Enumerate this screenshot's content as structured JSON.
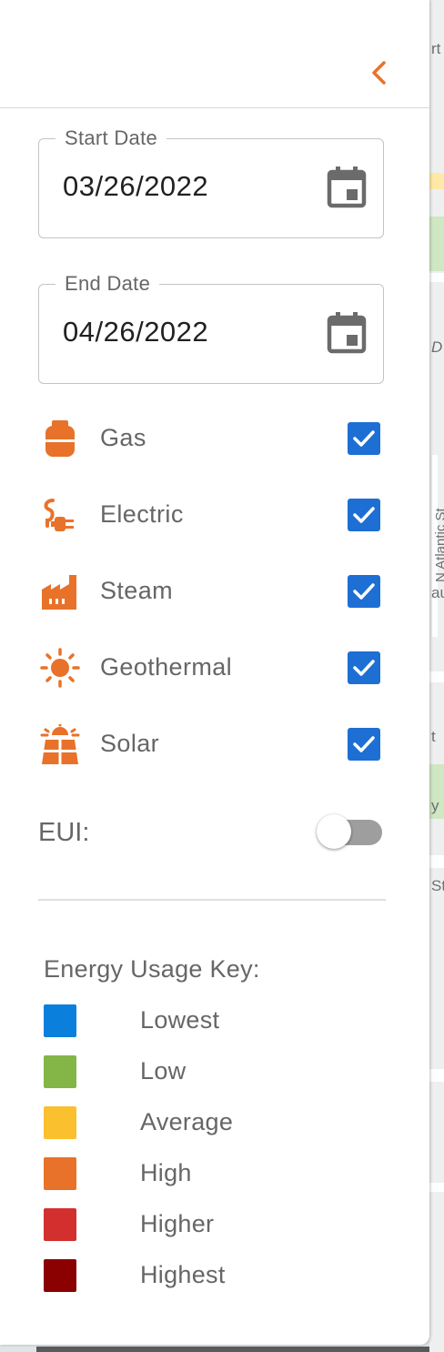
{
  "colors": {
    "accent_orange": "#e8722a",
    "checkbox_blue": "#1d6fd4",
    "text_gray": "#666666"
  },
  "header": {
    "collapse_icon": "chevron-left-icon"
  },
  "start_date": {
    "label": "Start Date",
    "value": "03/26/2022",
    "icon": "calendar-icon"
  },
  "end_date": {
    "label": "End Date",
    "value": "04/26/2022",
    "icon": "calendar-icon"
  },
  "utilities": [
    {
      "label": "Gas",
      "icon": "gas-tank-icon",
      "checked": true
    },
    {
      "label": "Electric",
      "icon": "power-plug-icon",
      "checked": true
    },
    {
      "label": "Steam",
      "icon": "factory-icon",
      "checked": true
    },
    {
      "label": "Geothermal",
      "icon": "sun-icon",
      "checked": true
    },
    {
      "label": "Solar",
      "icon": "solar-panel-icon",
      "checked": true
    }
  ],
  "eui": {
    "label": "EUI:",
    "enabled": false
  },
  "energy_key": {
    "title": "Energy Usage Key:",
    "items": [
      {
        "label": "Lowest",
        "color": "#0b7fdc"
      },
      {
        "label": "Low",
        "color": "#84b547"
      },
      {
        "label": "Average",
        "color": "#fbc02d"
      },
      {
        "label": "High",
        "color": "#e8722a"
      },
      {
        "label": "Higher",
        "color": "#d32f2f"
      },
      {
        "label": "Highest",
        "color": "#8b0000"
      }
    ]
  },
  "map": {
    "labels": [
      "rt",
      "D",
      "N Atlantic St",
      "au",
      "t",
      "y",
      "St"
    ]
  }
}
